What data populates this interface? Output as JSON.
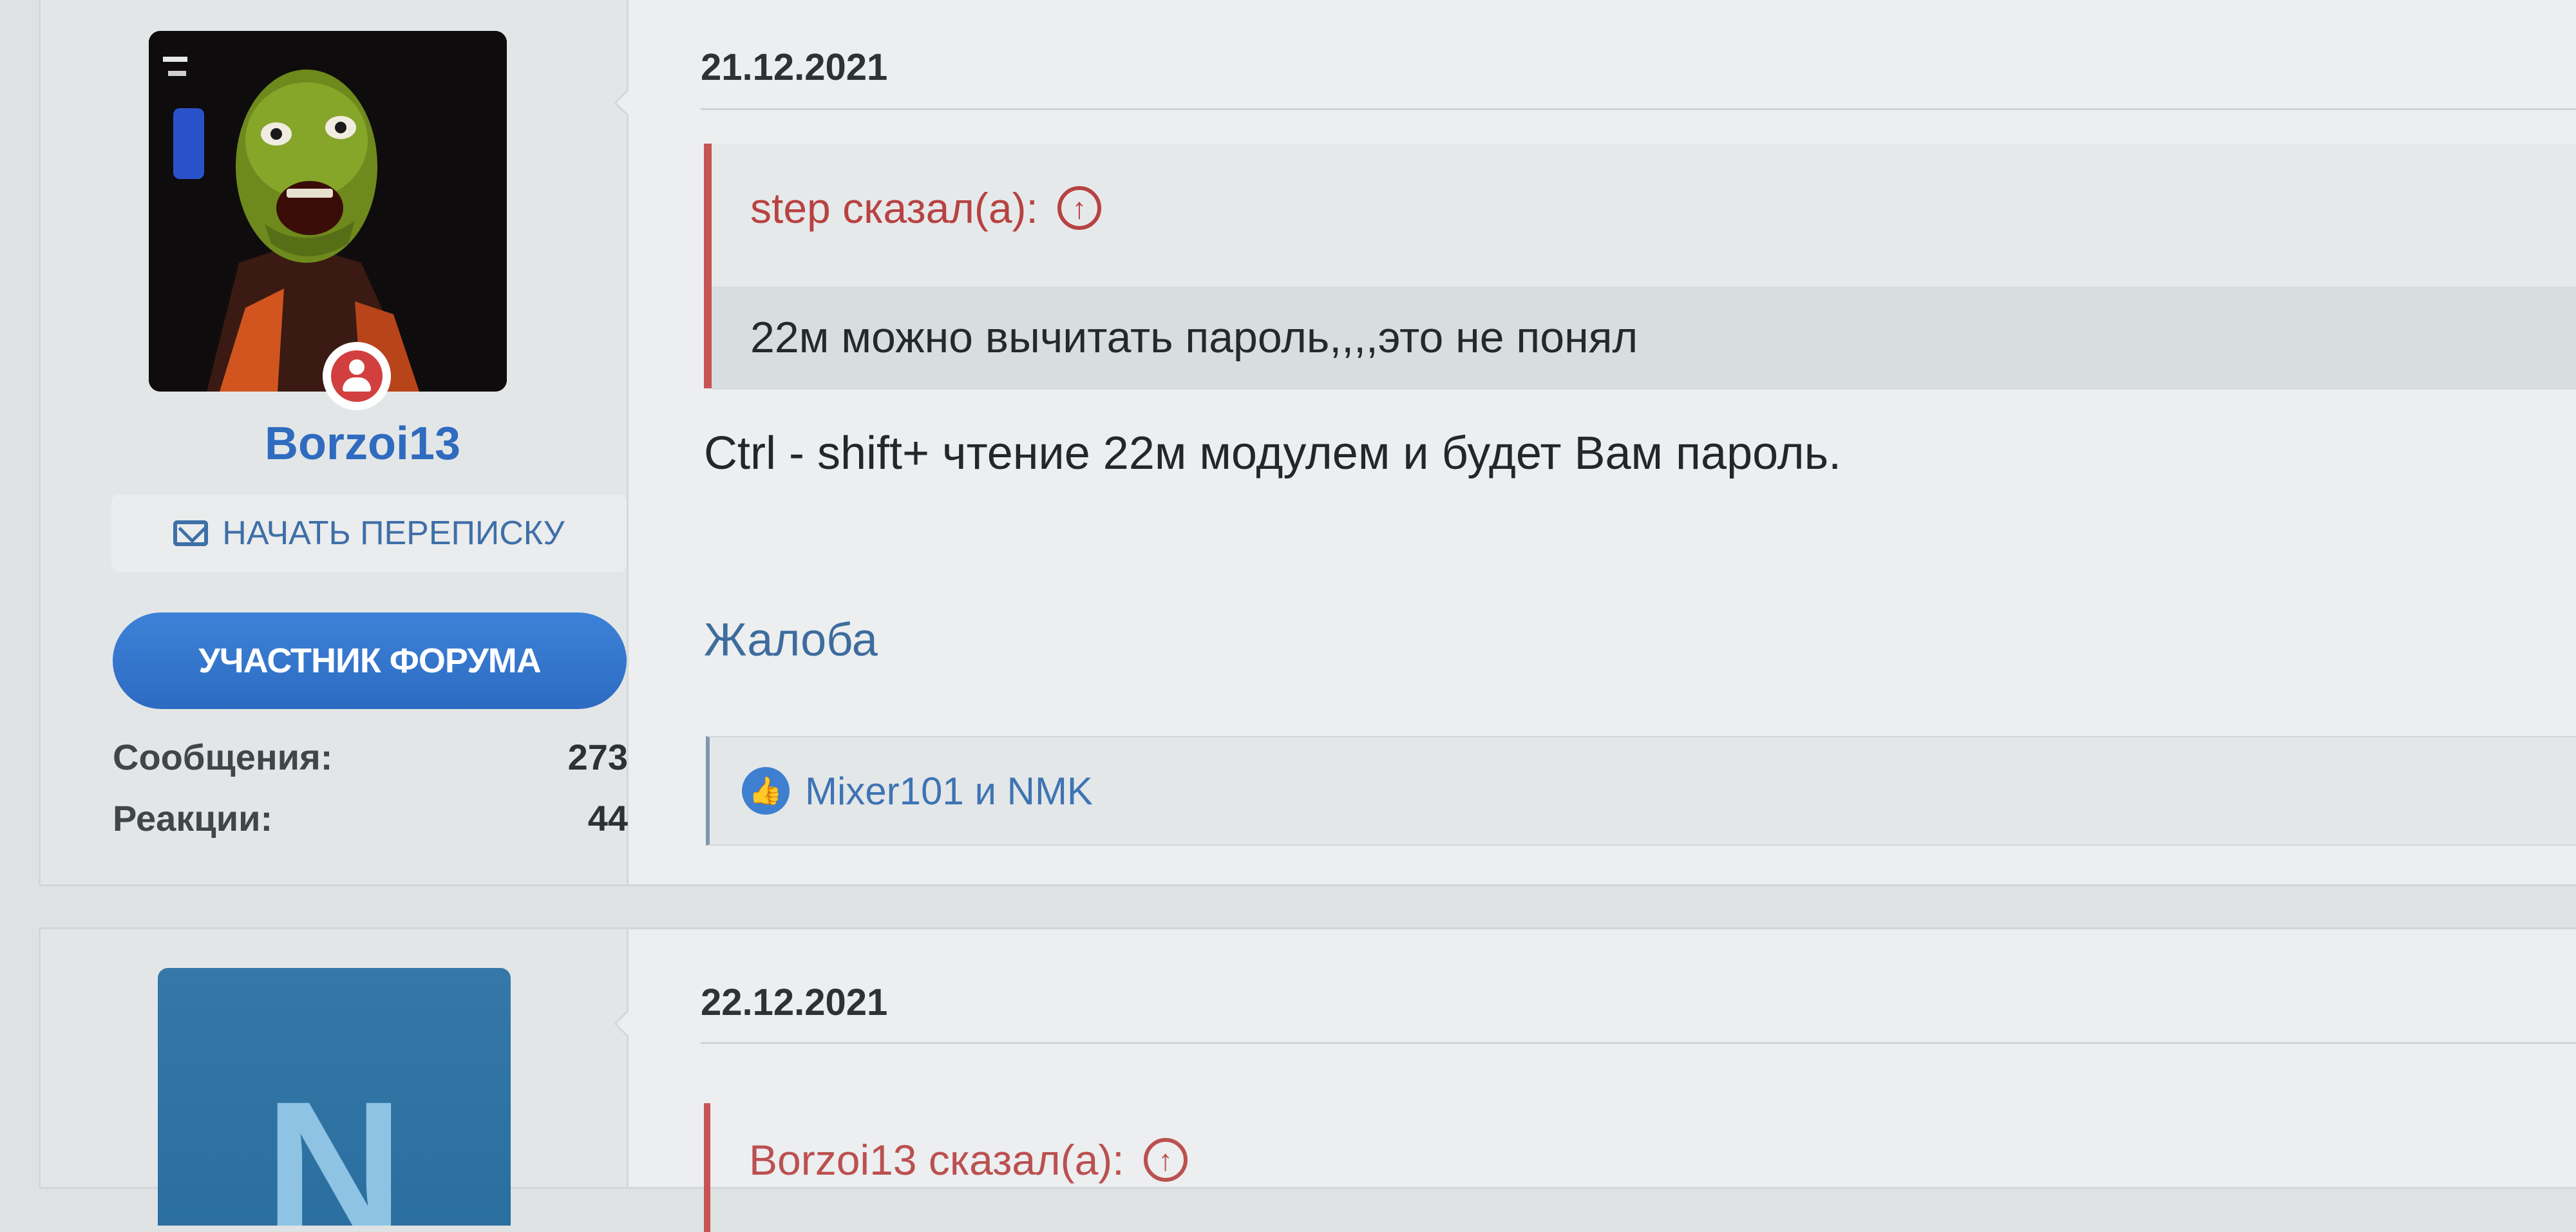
{
  "posts": [
    {
      "user": {
        "name": "Borzoi13",
        "start_conversation": "НАЧАТЬ ПЕРЕПИСКУ",
        "role": "УЧАСТНИК ФОРУМА",
        "stats": [
          {
            "label": "Сообщения:",
            "value": "273"
          },
          {
            "label": "Реакции:",
            "value": "44"
          }
        ]
      },
      "date": "21.12.2021",
      "quote": {
        "author_line": "step сказал(а):",
        "text": "22м можно вычитать пароль,,,,это не понял"
      },
      "message": "Ctrl - shift+ чтение 22м модулем и будет Вам пароль.",
      "report_label": "Жалоба",
      "reactions": "Mixer101 и NMK"
    },
    {
      "user": {
        "avatar_letter": "N"
      },
      "date": "22.12.2021",
      "quote": {
        "author_line": "Borzoi13 сказал(а):"
      }
    }
  ],
  "icons": {
    "online": "user-online-icon",
    "mail": "envelope-icon",
    "quote_up": "arrow-up-circle-icon",
    "like": "thumbs-up-icon"
  },
  "colors": {
    "username": "#2f6bbf",
    "role_badge": "#3479cf",
    "quote_accent": "#c75353",
    "link": "#3d6c9e"
  }
}
